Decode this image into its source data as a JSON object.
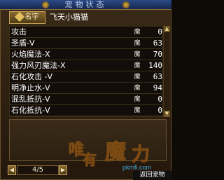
{
  "title": "宠物状态",
  "pet": {
    "tag_label": "名字",
    "name": "飞天小猫猫"
  },
  "mp_label": "魔",
  "skills": [
    {
      "name": "攻击",
      "cost": "0"
    },
    {
      "name": "圣盾-V",
      "cost": "63"
    },
    {
      "name": "火焰魔法-X",
      "cost": "70"
    },
    {
      "name": "强力风刃魔法-X",
      "cost": "140"
    },
    {
      "name": "石化攻击 -V",
      "cost": "63"
    },
    {
      "name": "明净止水-V",
      "cost": "94"
    },
    {
      "name": "混乱抵抗-V",
      "cost": "0"
    },
    {
      "name": "石化抵抗-V",
      "cost": "0"
    }
  ],
  "pagination": {
    "text": "4/5"
  },
  "watermark": {
    "chars": [
      "唯",
      "有",
      "魔",
      "力"
    ],
    "url": "pkmfi.com"
  },
  "back_label": "返回宠物",
  "colors": {
    "title_bar": "#2b4a86",
    "panel": "#3a2a18",
    "text": "#ffffff",
    "url": "#3fa8d0"
  }
}
